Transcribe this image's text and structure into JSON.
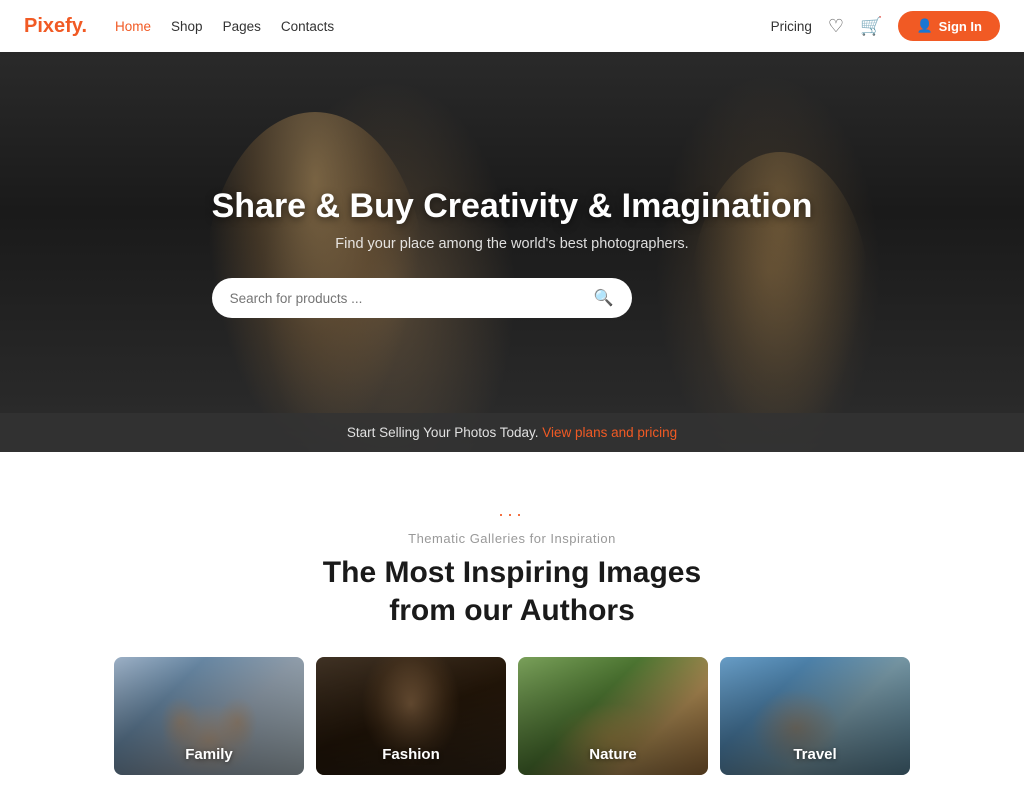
{
  "brand": {
    "name_start": "Pixefy",
    "name_dot": "."
  },
  "navbar": {
    "links": [
      {
        "label": "Home",
        "active": true
      },
      {
        "label": "Shop",
        "active": false
      },
      {
        "label": "Pages",
        "active": false
      },
      {
        "label": "Contacts",
        "active": false
      }
    ],
    "pricing_label": "Pricing",
    "signin_label": "Sign In"
  },
  "hero": {
    "title": "Share & Buy Creativity & Imagination",
    "subtitle": "Find your place among the world's best photographers.",
    "search_placeholder": "Search for products ...",
    "bottom_text": "Start Selling Your Photos Today.",
    "bottom_link": "View plans and pricing"
  },
  "galleries": {
    "dots": "...",
    "subtitle": "Thematic Galleries for Inspiration",
    "title_line1": "The Most Inspiring Images",
    "title_line2": "from our Authors",
    "cards": [
      {
        "label": "Family"
      },
      {
        "label": "Fashion"
      },
      {
        "label": "Nature"
      },
      {
        "label": "Travel"
      }
    ]
  }
}
